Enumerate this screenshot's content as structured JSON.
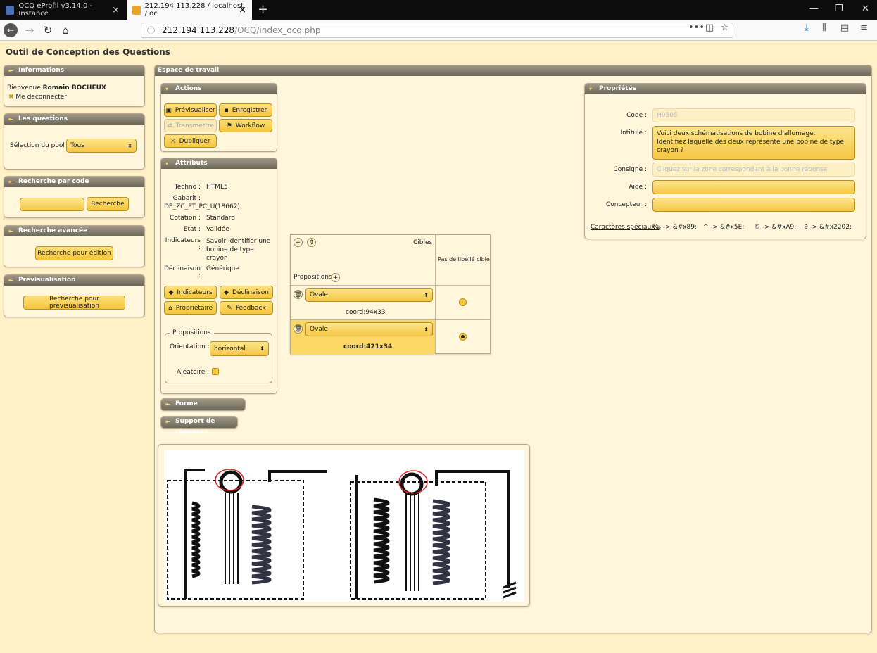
{
  "browser": {
    "tabs": [
      {
        "title": "OCQ eProfil v3.14.0 - Instance"
      },
      {
        "title": "212.194.113.228 / localhost / oc"
      }
    ],
    "url_info": "ⓘ",
    "url_host": "212.194.113.228",
    "url_path": "/OCQ/index_ocq.php"
  },
  "app": {
    "title": "Outil de Conception des Questions"
  },
  "sidebar": {
    "informations": {
      "header": "Informations",
      "welcome": "Bienvenue",
      "user": "Romain BOCHEUX",
      "logout": "Me deconnecter"
    },
    "questions": {
      "header": "Les questions",
      "pool_label": "Sélection du pool :",
      "pool_value": "Tous"
    },
    "search_code": {
      "header": "Recherche par code",
      "button": "Recherche"
    },
    "search_adv": {
      "header": "Recherche avancée",
      "button": "Recherche pour édition"
    },
    "preview": {
      "header": "Prévisualisation",
      "button": "Recherche pour prévisualisation"
    }
  },
  "workspace": {
    "header": "Espace de travail",
    "actions": {
      "header": "Actions",
      "preview": "Prévisualiser",
      "save": "Enregistrer",
      "transmit": "Transmettre",
      "workflow": "Workflow",
      "duplicate": "Dupliquer"
    },
    "attributes": {
      "header": "Attributs",
      "techno_label": "Techno :",
      "techno_value": "HTML5",
      "gabarit_label": "Gabarit :",
      "gabarit_value": "DE_ZC_PT_PC_U(18662)",
      "cotation_label": "Cotation :",
      "cotation_value": "Standard",
      "etat_label": "Etat :",
      "etat_value": "Validée",
      "indicateurs_label": "Indicateurs :",
      "indicateurs_value": "Savoir identifier une bobine de type crayon",
      "declinaison_label": "Déclinaison :",
      "declinaison_value": "Générique",
      "btn_indicateurs": "Indicateurs",
      "btn_declinaison": "Déclinaison",
      "btn_proprietaire": "Propriétaire",
      "btn_feedback": "Feedback",
      "propositions_legend": "Propositions",
      "orientation_label": "Orientation :",
      "orientation_value": "horizontal",
      "random_label": "Aléatoire :"
    },
    "forme": "Forme",
    "support": "Support de réponses",
    "grid": {
      "cibles": "Cibles",
      "propositions": "Propositions",
      "no_label": "Pas de libellé cible",
      "rows": [
        {
          "shape": "Ovale",
          "coord": "coord:94x33"
        },
        {
          "shape": "Ovale",
          "coord": "coord:421x34"
        }
      ]
    }
  },
  "properties": {
    "header": "Propriétés",
    "code_label": "Code :",
    "code_value": "H0505",
    "intitule_label": "Intitulé :",
    "intitule_line1": "Voici deux schématisations de bobine d'allumage.",
    "intitule_line2": "Identifiez laquelle des deux représente une bobine de type crayon ?",
    "consigne_label": "Consigne :",
    "consigne_value": "Cliquez sur la zone correspondant à la bonne réponse",
    "aide_label": "Aide :",
    "concepteur_label": "Concepteur :",
    "special_label": "Caractères spéciaux :",
    "special_chars": [
      "‰ -> &#x89;",
      "^ -> &#x5E;",
      "© -> &#xA9;",
      "∂ -> &#x2202;"
    ]
  }
}
